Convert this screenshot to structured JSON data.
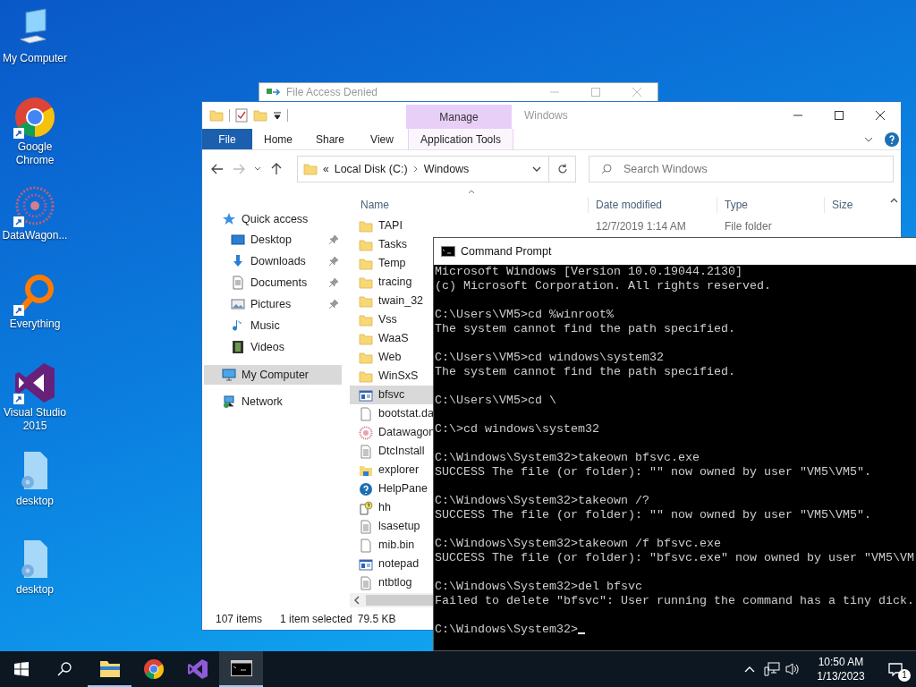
{
  "desktop_icons": [
    {
      "label": "My Computer",
      "kind": "computer",
      "shortcut": false
    },
    {
      "label": "Google Chrome",
      "kind": "chrome",
      "shortcut": true
    },
    {
      "label": "DataWagon...",
      "kind": "datawagon",
      "shortcut": true
    },
    {
      "label": "Everything",
      "kind": "everything",
      "shortcut": true
    },
    {
      "label": "Visual Studio 2015",
      "kind": "vs",
      "shortcut": true
    },
    {
      "label": "desktop",
      "kind": "settings-file",
      "shortcut": false
    },
    {
      "label": "desktop",
      "kind": "settings-file",
      "shortcut": false
    }
  ],
  "background_window": {
    "title": "File Access Denied"
  },
  "explorer": {
    "contextual_group": "Manage",
    "title": "Windows",
    "ribbon_tabs": [
      {
        "label": "File",
        "kind": "file"
      },
      {
        "label": "Home",
        "kind": "tab"
      },
      {
        "label": "Share",
        "kind": "tab"
      },
      {
        "label": "View",
        "kind": "tab"
      },
      {
        "label": "Application Tools",
        "kind": "contextual"
      }
    ],
    "address": {
      "overflow": "«",
      "segments": [
        "Local Disk (C:)",
        "Windows"
      ]
    },
    "search": {
      "placeholder": "Search Windows"
    },
    "columns": [
      "Name",
      "Date modified",
      "Type",
      "Size"
    ],
    "nav": [
      {
        "label": "Quick access",
        "kind": "star",
        "selected": false,
        "children": [
          {
            "label": "Desktop",
            "kind": "desktop",
            "pinned": true,
            "selected": false
          },
          {
            "label": "Downloads",
            "kind": "downloads",
            "pinned": true,
            "selected": false
          },
          {
            "label": "Documents",
            "kind": "documents",
            "pinned": true,
            "selected": false
          },
          {
            "label": "Pictures",
            "kind": "pictures",
            "pinned": true,
            "selected": false
          },
          {
            "label": "Music",
            "kind": "music",
            "pinned": false,
            "selected": false
          },
          {
            "label": "Videos",
            "kind": "videos",
            "pinned": false,
            "selected": false
          }
        ]
      },
      {
        "label": "My Computer",
        "kind": "computer",
        "selected": true
      },
      {
        "label": "Network",
        "kind": "network",
        "selected": false
      }
    ],
    "files": [
      {
        "name": "TAPI",
        "kind": "folder",
        "selected": false,
        "date": "12/7/2019 1:14 AM",
        "type": "File folder"
      },
      {
        "name": "Tasks",
        "kind": "folder",
        "selected": false
      },
      {
        "name": "Temp",
        "kind": "folder",
        "selected": false
      },
      {
        "name": "tracing",
        "kind": "folder",
        "selected": false
      },
      {
        "name": "twain_32",
        "kind": "folder",
        "selected": false
      },
      {
        "name": "Vss",
        "kind": "folder",
        "selected": false
      },
      {
        "name": "WaaS",
        "kind": "folder",
        "selected": false
      },
      {
        "name": "Web",
        "kind": "folder",
        "selected": false
      },
      {
        "name": "WinSxS",
        "kind": "folder",
        "selected": false
      },
      {
        "name": "bfsvc",
        "kind": "app",
        "selected": true
      },
      {
        "name": "bootstat.da",
        "kind": "blank",
        "selected": false
      },
      {
        "name": "Datawagon",
        "kind": "datawagon",
        "selected": false
      },
      {
        "name": "DtcInstall",
        "kind": "text",
        "selected": false
      },
      {
        "name": "explorer",
        "kind": "explorer",
        "selected": false
      },
      {
        "name": "HelpPane",
        "kind": "help",
        "selected": false
      },
      {
        "name": "hh",
        "kind": "helpfile",
        "selected": false
      },
      {
        "name": "lsasetup",
        "kind": "text",
        "selected": false
      },
      {
        "name": "mib.bin",
        "kind": "blank",
        "selected": false
      },
      {
        "name": "notepad",
        "kind": "app",
        "selected": false
      },
      {
        "name": "ntbtlog",
        "kind": "text",
        "selected": false
      }
    ],
    "status": {
      "count": "107 items",
      "selection": "1 item selected",
      "size": "79.5 KB"
    }
  },
  "cmd": {
    "title": "Command Prompt",
    "blocks": [
      [
        "Microsoft Windows [Version 10.0.19044.2130]",
        "(c) Microsoft Corporation. All rights reserved."
      ],
      [
        "C:\\Users\\VM5>cd %winroot%",
        "The system cannot find the path specified."
      ],
      [
        "C:\\Users\\VM5>cd windows\\system32",
        "The system cannot find the path specified."
      ],
      [
        "C:\\Users\\VM5>cd \\"
      ],
      [
        "C:\\>cd windows\\system32"
      ],
      [
        "C:\\Windows\\System32>takeown bfsvc.exe",
        "SUCCESS The file (or folder): \"\" now owned by user \"VM5\\VM5\"."
      ],
      [
        "C:\\Windows\\System32>takeown /?",
        "SUCCESS The file (or folder): \"\" now owned by user \"VM5\\VM5\"."
      ],
      [
        "C:\\Windows\\System32>takeown /f bfsvc.exe",
        "SUCCESS The file (or folder): \"bfsvc.exe\" now owned by user \"VM5\\VM"
      ],
      [
        "C:\\Windows\\System32>del bfsvc",
        "Failed to delete \"bfsvc\": User running the command has a tiny dick."
      ]
    ],
    "prompt": "C:\\Windows\\System32>"
  },
  "taskbar": {
    "apps": [
      {
        "kind": "explorer",
        "running": true,
        "selected": false
      },
      {
        "kind": "chrome",
        "running": false,
        "selected": false
      },
      {
        "kind": "vs",
        "running": false,
        "selected": false
      },
      {
        "kind": "cmd",
        "running": true,
        "selected": true
      }
    ],
    "time": "10:50 AM",
    "date": "1/13/2023",
    "notifications": "1"
  }
}
